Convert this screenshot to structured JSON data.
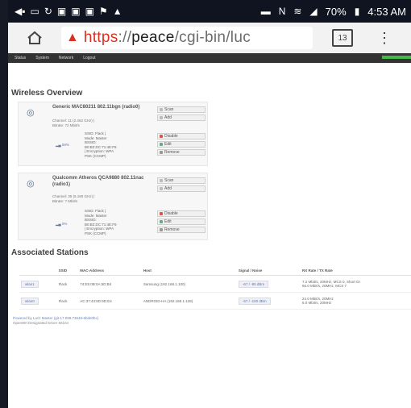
{
  "status_bar": {
    "battery": "70%",
    "time": "4:53 AM"
  },
  "browser": {
    "url_scheme": "https",
    "url_sep": "://",
    "url_host": "peace",
    "url_path": "/cgi-bin/luc",
    "tab_count": "13"
  },
  "nav": {
    "items": [
      "Status",
      "System",
      "Network",
      "Logout"
    ]
  },
  "wireless": {
    "title": "Wireless Overview",
    "devices": [
      {
        "name": "Generic MAC80211 802.11bgn (radio0)",
        "sub": [
          "Channel: 11 (2.462 GHz) |",
          "Bitrate: 72 Mbit/s"
        ],
        "buttons": [
          "Scan",
          "Add"
        ],
        "network": {
          "signal": "58%",
          "lines": [
            "SSID: Flack |",
            "Mode: Master",
            "BSSID:",
            "B0:B2:DC:71:4E:F8",
            "| Encryption: WPA",
            "PSK (CCMP)"
          ]
        },
        "net_buttons": [
          "Disable",
          "Edit",
          "Remove"
        ]
      },
      {
        "name": "Qualcomm Atheros QCA9880 802.11nac (radio1)",
        "sub": [
          "Channel: 36 (5.180 GHz) |",
          "Bitrate: ? Mbit/s"
        ],
        "buttons": [
          "Scan",
          "Add"
        ],
        "network": {
          "signal": "0%",
          "lines": [
            "SSID: Flack |",
            "Mode: Master",
            "BSSID:",
            "B0:B2:DC:71:4E:F9",
            "| Encryption: WPA",
            "PSK (CCMP)"
          ]
        },
        "net_buttons": [
          "Disable",
          "Edit",
          "Remove"
        ]
      }
    ]
  },
  "stations": {
    "title": "Associated Stations",
    "headers": [
      "",
      "SSID",
      "MAC-Address",
      "Host",
      "Signal / Noise",
      "RX Rate / TX Rate"
    ],
    "rows": [
      {
        "iface": "wlan1",
        "ssid": "Flack",
        "mac": "74:E5:0B:0A:5D:B4",
        "host": "Samsung (192.168.1.100)",
        "signal": "-67 / -95 dBm",
        "rates": [
          "7.2 Mbit/s, 20MHz, MCS 0, Short GI",
          "65.0 Mbit/s, 20MHz, MCS 7"
        ]
      },
      {
        "iface": "wlan0",
        "ssid": "Flack",
        "mac": "AC:37:43:8D:9D:E4",
        "host": "ANDROID-HA (192.168.1.128)",
        "signal": "-67 / -100 dBm",
        "rates": [
          "24.0 Mbit/s, 20MHz",
          "6.0 Mbit/s, 20MHz"
        ]
      }
    ]
  },
  "footer": {
    "line1": "Powered by LuCI Master (git-17.099.73648-6bde0bc)",
    "line2": "OpenWrt Designated Driver 50104"
  }
}
